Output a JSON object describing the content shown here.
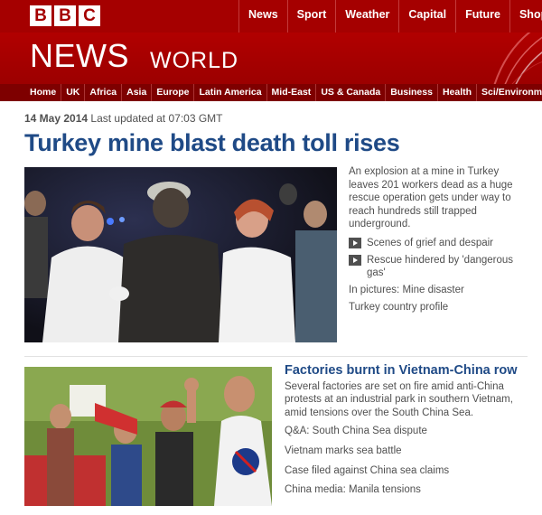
{
  "brand": {
    "letters": [
      "B",
      "B",
      "C"
    ]
  },
  "top_nav": [
    "News",
    "Sport",
    "Weather",
    "Capital",
    "Future",
    "Shop"
  ],
  "banner": {
    "title": "NEWS",
    "section": "WORLD"
  },
  "section_nav": [
    "Home",
    "UK",
    "Africa",
    "Asia",
    "Europe",
    "Latin America",
    "Mid-East",
    "US & Canada",
    "Business",
    "Health",
    "Sci/Environment"
  ],
  "dateline": {
    "date": "14 May 2014",
    "updated": "Last updated at 07:03 GMT"
  },
  "main_story": {
    "headline": "Turkey mine blast death toll rises",
    "summary": "An explosion at a mine in Turkey leaves 201 workers dead as a huge rescue operation gets under way to reach hundreds still trapped underground.",
    "video_links": [
      "Scenes of grief and despair",
      "Rescue hindered by 'dangerous gas'"
    ],
    "links": [
      "In pictures: Mine disaster",
      "Turkey country profile"
    ]
  },
  "second_story": {
    "headline": "Factories burnt in Vietnam-China row",
    "summary": "Several factories are set on fire amid anti-China protests at an industrial park in southern Vietnam, amid tensions over the South China Sea.",
    "links": [
      "Q&A: South China Sea dispute",
      "Vietnam marks sea battle",
      "Case filed against China sea claims",
      "China media: Manila tensions"
    ]
  },
  "colors": {
    "brand_red": "#a50000",
    "section_nav_red": "#7e0000",
    "headline_blue": "#1f4a86"
  }
}
